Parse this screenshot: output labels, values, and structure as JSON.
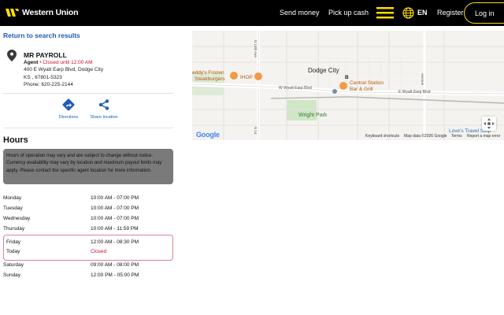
{
  "header": {
    "brand": "Western Union",
    "nav": {
      "send_money": "Send money",
      "pick_up_cash": "Pick up cash"
    },
    "language": "EN",
    "register": "Register",
    "login": "Log in",
    "accent_color": "#ffdd00"
  },
  "back_link": "Return to search results",
  "agent": {
    "name": "MR PAYROLL",
    "type": "Agent",
    "status": "Closed until 12:00 AM",
    "address_line1": "400 E Wyatt Earp Blvd, Dodge City",
    "address_line2": "KS , 67801-5323",
    "phone": "Phone: 620-225-2144"
  },
  "actions": {
    "directions": "Directions",
    "share": "Share location"
  },
  "hours": {
    "title": "Hours",
    "notice": "Hours of operation may vary and are subject to change without notice. Currency availability may vary by location and maximum payout limits may apply. Please contact the specific agent location for more information.",
    "days": [
      {
        "day": "Monday",
        "time": "10:00 AM - 07:00 PM"
      },
      {
        "day": "Tuesday",
        "time": "10:00 AM - 07:00 PM"
      },
      {
        "day": "Wednesday",
        "time": "10:00 AM - 07:00 PM"
      },
      {
        "day": "Thursday",
        "time": "10:00 AM - 11:59 PM"
      },
      {
        "day": "Friday",
        "time": "12:00 AM - 08:30 PM"
      },
      {
        "day": "Saturday",
        "time": "09:00 AM - 08:00 PM"
      },
      {
        "day": "Sunday",
        "time": "12:00 PM - 05:00 PM"
      }
    ],
    "today_label": "Today",
    "today_status": "Closed"
  },
  "map": {
    "city": "Dodge City",
    "poi_freddys": "eddy's Frozen",
    "poi_freddys2": "Steakburgers",
    "poi_ihop": "IHOP",
    "poi_central": "Central Station",
    "poi_central2": "Bar & Grill",
    "park": "Wright Park",
    "street_wyatt_w": "W Wyatt Earp Blvd",
    "street_wyatt_e": "E Wyatt Earp Blvd",
    "street_n14": "N 14th Ave",
    "street_n14_lower": "N 14",
    "street_avenue": "Avenue",
    "pin_label": "B",
    "poi_loves": "Love's Travel Stop",
    "google": "Google",
    "footer_shortcuts": "Keyboard shortcuts",
    "footer_data": "Map data ©2026 Google",
    "footer_terms": "Terms",
    "footer_report": "Report a map error"
  }
}
